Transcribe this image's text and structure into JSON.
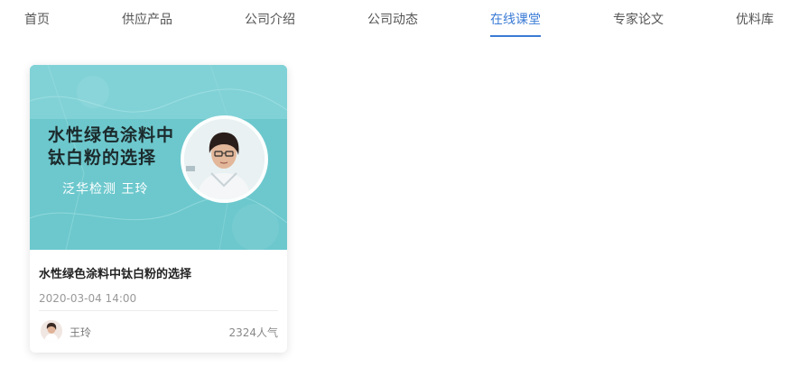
{
  "nav": {
    "items": [
      {
        "label": "首页"
      },
      {
        "label": "供应产品"
      },
      {
        "label": "公司介绍"
      },
      {
        "label": "公司动态"
      },
      {
        "label": "在线课堂",
        "active": true
      },
      {
        "label": "专家论文"
      },
      {
        "label": "优料库"
      }
    ],
    "active_color": "#3a7bd5"
  },
  "course": {
    "cover_title_line1": "水性绿色涂料中",
    "cover_title_line2": "钛白粉的选择",
    "cover_subtitle": "泛华检测  王玲",
    "title": "水性绿色涂料中钛白粉的选择",
    "date": "2020-03-04 14:00",
    "author": "王玲",
    "views": "2324人气",
    "cover_color": "#6cc8cd"
  }
}
